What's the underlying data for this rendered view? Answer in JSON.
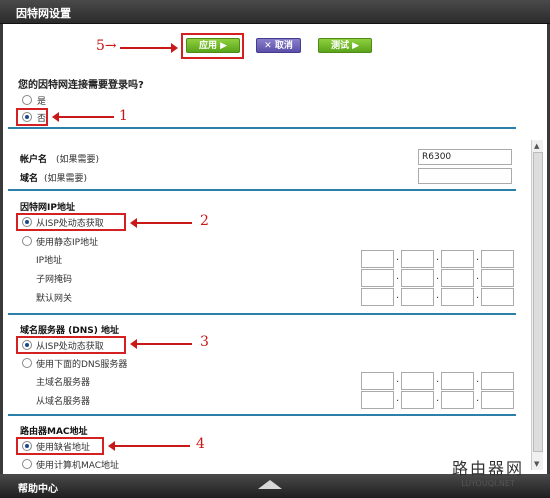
{
  "window": {
    "title": "因特网设置"
  },
  "toolbar": {
    "apply_label": "应用 ▶",
    "cancel_label": "✕ 取消",
    "test_label": "测试 ▶"
  },
  "login_section": {
    "question": "您的因特网连接需要登录吗?",
    "option_yes": "是",
    "option_no": "否",
    "selected": "否"
  },
  "account": {
    "account_label": "帐户名",
    "account_hint": "(如果需要)",
    "account_value": "R6300",
    "domain_label": "域名",
    "domain_hint": "(如果需要)",
    "domain_value": ""
  },
  "ip_section": {
    "title": "因特网IP地址",
    "option_dynamic": "从ISP处动态获取",
    "option_static": "使用静态IP地址",
    "selected": "从ISP处动态获取",
    "ip_label": "IP地址",
    "mask_label": "子网掩码",
    "gateway_label": "默认网关"
  },
  "dns_section": {
    "title": "域名服务器 (DNS) 地址",
    "option_dynamic": "从ISP处动态获取",
    "option_manual": "使用下面的DNS服务器",
    "selected": "从ISP处动态获取",
    "primary_label": "主域名服务器",
    "secondary_label": "从域名服务器"
  },
  "mac_section": {
    "title": "路由器MAC地址",
    "option_default": "使用缺省地址",
    "option_computer": "使用计算机MAC地址",
    "selected": "使用缺省地址"
  },
  "annotations": {
    "n1": "1",
    "n2": "2",
    "n3": "3",
    "n4": "4",
    "n5": "5→"
  },
  "footer": {
    "help_label": "帮助中心"
  },
  "watermark": {
    "big": "路由器网",
    "small": "LUYOUQI.NET"
  }
}
